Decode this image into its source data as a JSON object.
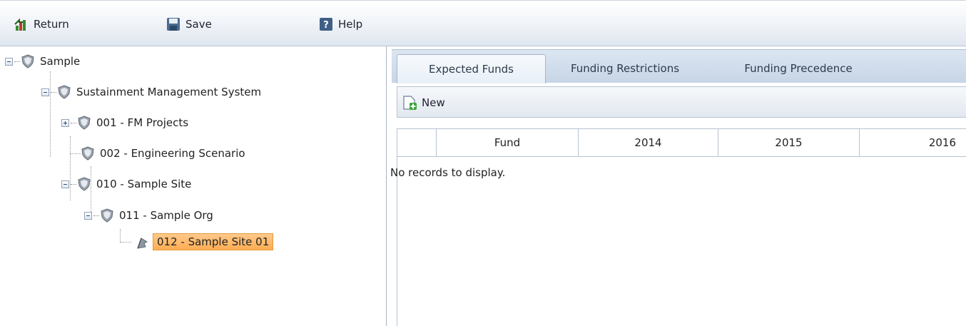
{
  "toolbar": {
    "return_label": "Return",
    "save_label": "Save",
    "help_label": "Help"
  },
  "tree": {
    "nodes": [
      {
        "label": "Sample"
      },
      {
        "label": "Sustainment Management System"
      },
      {
        "label": "001 - FM Projects"
      },
      {
        "label": "002 - Engineering Scenario"
      },
      {
        "label": "010 - Sample Site"
      },
      {
        "label": "011 - Sample Org"
      },
      {
        "label": "012 - Sample Site 01"
      }
    ]
  },
  "tabs": [
    {
      "label": "Expected Funds",
      "active": true
    },
    {
      "label": "Funding Restrictions"
    },
    {
      "label": "Funding Precedence"
    }
  ],
  "grid": {
    "new_label": "New",
    "columns": [
      "",
      "Fund",
      "2014",
      "2015",
      "2016"
    ],
    "empty_message": "No records to display."
  },
  "colors": {
    "selection": "#ffad52",
    "tabstrip": "#c7d5e6"
  }
}
